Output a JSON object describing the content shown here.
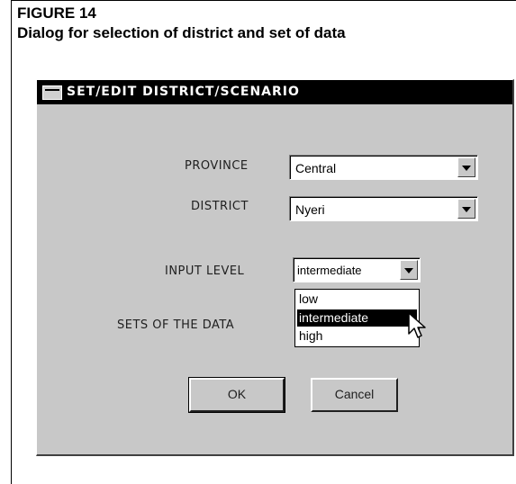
{
  "figure": {
    "number": "FIGURE 14",
    "caption": "Dialog for selection of district and set of data"
  },
  "dialog": {
    "title": "SET/EDIT  DISTRICT/SCENARIO",
    "province": {
      "label": "PROVINCE",
      "value": "Central"
    },
    "district": {
      "label": "DISTRICT",
      "value": "Nyeri"
    },
    "input_level": {
      "label": "INPUT LEVEL",
      "value": "intermediate",
      "options": [
        "low",
        "intermediate",
        "high"
      ],
      "highlighted": "intermediate"
    },
    "sets_of_data": {
      "label": "SETS OF THE DATA"
    },
    "ok_label": "OK",
    "cancel_label": "Cancel"
  },
  "icons": {
    "system_menu": "system-menu-icon",
    "dropdown": "chevron-down-icon",
    "cursor": "arrow-cursor-icon"
  }
}
